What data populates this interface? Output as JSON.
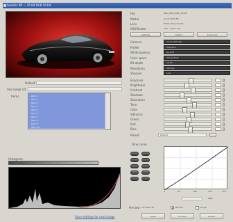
{
  "window": {
    "title": "Generic NP — 16 Bit RGB 16 bit"
  },
  "left": {
    "profile_label": "Default",
    "range_label": "Use range 1/1",
    "list_label": "Items",
    "list_items": [
      "Item 1",
      "Item 2",
      "Item 3",
      "Item 4",
      "Item 5",
      "Item 6",
      "Item 7",
      "Item 8",
      "Item 9",
      "Item 10"
    ],
    "histogram_label": "Histogram"
  },
  "info": {
    "rows": [
      {
        "label": "File",
        "value": "IMG_0001_RAW_16.tiff"
      },
      {
        "label": "Model",
        "value": "Canon EOS 5D"
      },
      {
        "label": "Lens",
        "value": "EF 24-70mm f/2.8L"
      },
      {
        "label": "ISO/Shutter",
        "value": "100 · 1/125 · f/8"
      }
    ],
    "tabs": [
      "Settings",
      "Output",
      "Advanced"
    ]
  },
  "settings": {
    "rows": [
      {
        "label": "Camera",
        "value": "Canon EOS 5D"
      },
      {
        "label": "Profile",
        "value": "Standard"
      },
      {
        "label": "White balance",
        "value": "As shot"
      },
      {
        "label": "Color space",
        "value": "Adobe RGB"
      },
      {
        "label": "Bit depth",
        "value": "16 bit"
      },
      {
        "label": "Resolution",
        "value": "300 dpi"
      },
      {
        "label": "Sharpen",
        "value": "Low"
      }
    ]
  },
  "adjust": {
    "rows": [
      {
        "label": "Exposure",
        "value": 0.55
      },
      {
        "label": "Brightness",
        "value": 0.45
      },
      {
        "label": "Contrast",
        "value": 0.6
      },
      {
        "label": "Shadows",
        "value": 0.35
      },
      {
        "label": "Saturation",
        "value": 0.5
      },
      {
        "label": "Tone",
        "value": 0.62
      },
      {
        "label": "Color",
        "value": 0.4
      },
      {
        "label": "Vibrance",
        "value": 0.58
      },
      {
        "label": "Green",
        "value": 0.5
      },
      {
        "label": "Red",
        "value": 0.47
      },
      {
        "label": "Blue",
        "value": 0.53
      }
    ],
    "preset_label": "Preset",
    "preset_value": "Default"
  },
  "curve": {
    "label": "Tone curve",
    "x_ticks": [
      "0",
      "64",
      "128",
      "192",
      "255"
    ],
    "right_label": "RGB"
  },
  "bottom": {
    "mode_label": "Preview",
    "mode_value": "All Views 16",
    "radio_a": "Normal",
    "radio_b": "Large",
    "footer_link": "Save settings for next image",
    "buttons": [
      "Open",
      "Process",
      "Cancel"
    ]
  },
  "colors": {
    "accent": "#2e56a0",
    "dark_field": "#3c3c3c"
  }
}
